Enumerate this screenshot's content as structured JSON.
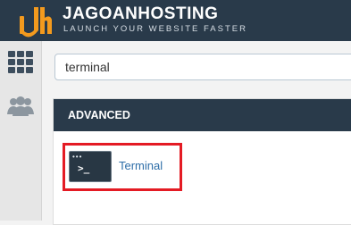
{
  "header": {
    "brand": "JAGOANHOSTING",
    "tagline": "LAUNCH YOUR WEBSITE FASTER",
    "logo_icon": "jh-logo-icon",
    "background": "#293a4a",
    "logo_color": "#f39a1e"
  },
  "sidebar": {
    "items": [
      {
        "icon": "grid-icon",
        "active": true
      },
      {
        "icon": "users-icon",
        "active": false
      }
    ]
  },
  "search": {
    "value": "terminal"
  },
  "results": {
    "section_title": "ADVANCED",
    "items": [
      {
        "label": "Terminal",
        "icon": "terminal-icon",
        "icon_text": "•••",
        "prompt": ">_",
        "highlighted": true,
        "highlight_color": "#e41b24"
      }
    ]
  }
}
